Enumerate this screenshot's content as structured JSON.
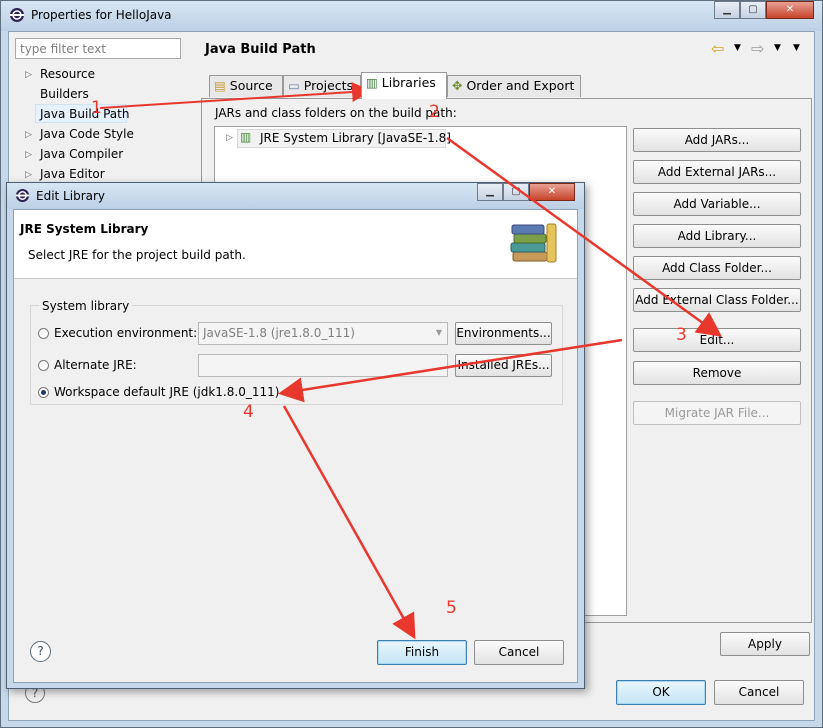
{
  "main_window": {
    "title": "Properties for HelloJava",
    "filter_placeholder": "type filter text",
    "nav_items": [
      {
        "label": "Resource",
        "expandable": true
      },
      {
        "label": "Builders",
        "expandable": false
      },
      {
        "label": "Java Build Path",
        "expandable": false,
        "selected": true
      },
      {
        "label": "Java Code Style",
        "expandable": true
      },
      {
        "label": "Java Compiler",
        "expandable": true
      },
      {
        "label": "Java Editor",
        "expandable": true
      }
    ],
    "page_title": "Java Build Path",
    "tabs": [
      {
        "label": "Source",
        "icon": "folder-icon"
      },
      {
        "label": "Projects",
        "icon": "projects-icon"
      },
      {
        "label": "Libraries",
        "icon": "library-icon",
        "active": true
      },
      {
        "label": "Order and Export",
        "icon": "order-icon"
      }
    ],
    "build_path_label": "JARs and class folders on the build path:",
    "library_entry": "JRE System Library [JavaSE-1.8]",
    "buttons": {
      "add_jars": "Add JARs...",
      "add_external_jars": "Add External JARs...",
      "add_variable": "Add Variable...",
      "add_library": "Add Library...",
      "add_class_folder": "Add Class Folder...",
      "add_external_class_folder": "Add External Class Folder...",
      "edit": "Edit...",
      "remove": "Remove",
      "migrate_jar": "Migrate JAR File...",
      "apply": "Apply",
      "ok": "OK",
      "cancel": "Cancel"
    }
  },
  "edit_dialog": {
    "title": "Edit Library",
    "header_title": "JRE System Library",
    "header_desc": "Select JRE for the project build path.",
    "group_label": "System library",
    "options": [
      {
        "label": "Execution environment:",
        "value": "JavaSE-1.8 (jre1.8.0_111)",
        "button": "Environments...",
        "selected": false
      },
      {
        "label": "Alternate JRE:",
        "value": "",
        "button": "Installed JREs...",
        "selected": false
      },
      {
        "label": "Workspace default JRE (jdk1.8.0_111)",
        "selected": true
      }
    ],
    "finish": "Finish",
    "cancel": "Cancel"
  },
  "annotations": [
    "1",
    "2",
    "3",
    "4",
    "5"
  ],
  "colors": {
    "annotation": "#e8382e",
    "title_bar": "#c6d8ea",
    "default_button": "#3c7fb1"
  }
}
